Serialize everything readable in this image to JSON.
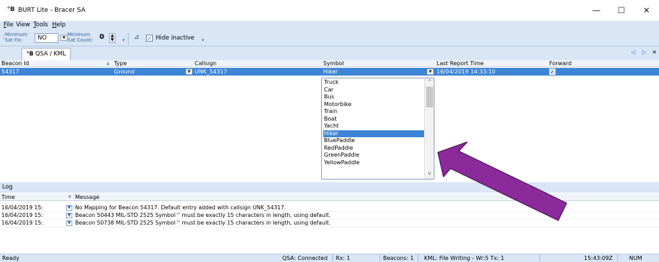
{
  "window": {
    "title": "BURT Lite - Bracer SA",
    "icon": "burt-app-icon",
    "controls": [
      "—",
      "☐",
      "✕"
    ]
  },
  "menu": [
    {
      "label": "File",
      "mnemonic": "F"
    },
    {
      "label": "View",
      "mnemonic": ""
    },
    {
      "label": "Tools",
      "mnemonic": "T"
    },
    {
      "label": "Help",
      "mnemonic": "H"
    }
  ],
  "toolbar": {
    "min_sat_fix_label_1": "Minimum",
    "min_sat_fix_label_2": "Sat Fix:",
    "min_sat_fix_value": "NO",
    "min_sat_count_label_1": "Minimum",
    "min_sat_count_label_2": "Sat Count:",
    "min_sat_count_value": "0",
    "hide_inactive_label": "Hide inactive",
    "hide_inactive_checked": true
  },
  "tabs": [
    {
      "label": "QSA / KML",
      "active": true
    }
  ],
  "tab_nav": {
    "prev": "◁",
    "next": "▷",
    "close": "✕"
  },
  "grid": {
    "columns": [
      "Beacon Id",
      "Type",
      "Callsign",
      "Symbol",
      "Last Report Time",
      "Forward"
    ],
    "rows": [
      {
        "beacon_id": "54317",
        "type": "Ground",
        "callsign": "UNK_54317",
        "symbol": "Hiker",
        "last_report_time": "16/04/2019 14:33:10",
        "forward": true
      }
    ]
  },
  "symbol_dropdown": {
    "options": [
      "Truck",
      "Car",
      "Bus",
      "Motorbike",
      "Train",
      "Boat",
      "Yacht",
      "Hiker",
      "BluePaddle",
      "RedPaddle",
      "GreenPaddle",
      "YellowPaddle"
    ],
    "selected": "Hiker"
  },
  "log": {
    "title": "Log",
    "columns": [
      "Time",
      "Message"
    ],
    "rows": [
      {
        "time": "16/04/2019 15:",
        "message": "No Mapping for Beacon 54317. Default entry added with callsign UNK_54317."
      },
      {
        "time": "16/04/2019 15:",
        "message": "Beacon 50443 MIL-STD 2525 Symbol '' must be exactly 15 characters in length, using default."
      },
      {
        "time": "16/04/2019 15:",
        "message": "Beacon 50738 MIL-STD 2525 Symbol '' must be exactly 15 characters in length, using default."
      }
    ]
  },
  "status": {
    "ready": "Ready",
    "qsa": "QSA: Connected",
    "rx": "Rx: 1",
    "beacons": "Beacons: 1",
    "kml": "KML: File Writing - Wr:5 Tx: 1",
    "clock": "15:43:09Z",
    "num": "NUM"
  },
  "colors": {
    "chrome": "#d8e6f5",
    "selection": "#3d84d6",
    "arrow_fill": "#8b2b9b",
    "arrow_outline": "#5b1a66"
  }
}
